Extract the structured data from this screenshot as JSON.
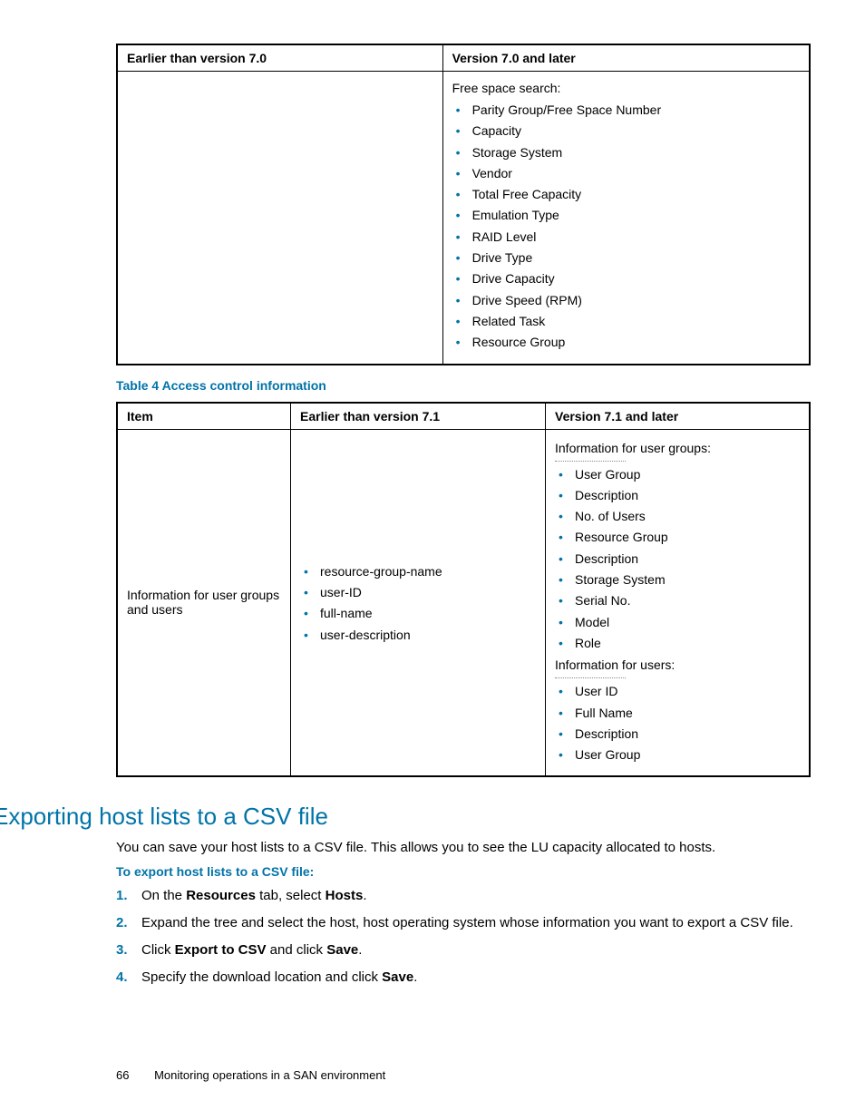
{
  "table1": {
    "headers": {
      "left": "Earlier than version 7.0",
      "right": "Version 7.0 and later"
    },
    "rightIntro": "Free space search:",
    "rightItems": [
      "Parity Group/Free Space Number",
      "Capacity",
      "Storage System",
      "Vendor",
      "Total Free Capacity",
      "Emulation Type",
      "RAID Level",
      "Drive Type",
      "Drive Capacity",
      "Drive Speed (RPM)",
      "Related Task",
      "Resource Group"
    ]
  },
  "table2caption": "Table 4 Access control information",
  "table2": {
    "headers": {
      "c1": "Item",
      "c2": "Earlier than version 7.1",
      "c3": "Version 7.1 and later"
    },
    "row": {
      "item": "Information for user groups and users",
      "earlierItems": [
        "resource-group-name",
        "user-ID",
        "full-name",
        "user-description"
      ],
      "laterIntro1": "Information for user groups:",
      "laterItems1": [
        "User Group",
        "Description",
        "No. of Users",
        "Resource Group",
        "Description",
        "Storage System",
        "Serial No.",
        "Model",
        "Role"
      ],
      "laterIntro2": "Information for users:",
      "laterItems2": [
        "User ID",
        "Full Name",
        "Description",
        "User Group"
      ]
    }
  },
  "sectionTitle": "Exporting host lists to a CSV file",
  "sectionPara": "You can save your host lists to a CSV file. This allows you to see the LU capacity allocated to hosts.",
  "procHead": "To export host lists to a CSV file:",
  "steps": {
    "s1a": "On the ",
    "s1b": "Resources",
    "s1c": " tab, select ",
    "s1d": "Hosts",
    "s1e": ".",
    "s2": "Expand the tree and select the host, host operating system whose information you want to export a CSV file.",
    "s3a": "Click ",
    "s3b": "Export to CSV",
    "s3c": " and click ",
    "s3d": "Save",
    "s3e": ".",
    "s4a": "Specify the download location and click ",
    "s4b": "Save",
    "s4c": "."
  },
  "footer": {
    "page": "66",
    "title": "Monitoring operations in a SAN environment"
  }
}
